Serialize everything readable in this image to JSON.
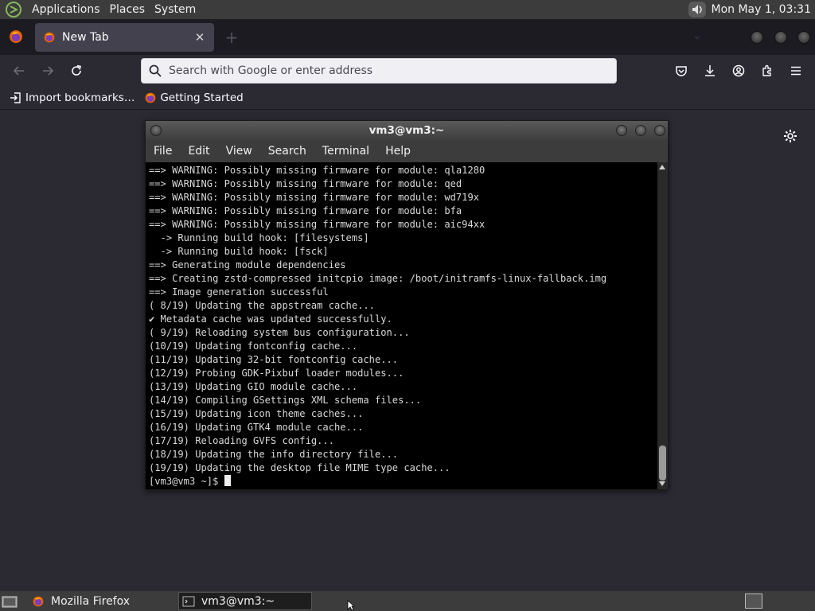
{
  "top_panel": {
    "menus": [
      "Applications",
      "Places",
      "System"
    ],
    "clock": "Mon May  1, 03:31"
  },
  "browser": {
    "tab_title": "New Tab",
    "url_placeholder": "Search with Google or enter address",
    "bookmarks": [
      "Import bookmarks…",
      "Getting Started"
    ]
  },
  "terminal": {
    "title": "vm3@vm3:~",
    "menus": [
      "File",
      "Edit",
      "View",
      "Search",
      "Terminal",
      "Help"
    ],
    "lines": [
      "==> WARNING: Possibly missing firmware for module: qla1280",
      "==> WARNING: Possibly missing firmware for module: qed",
      "==> WARNING: Possibly missing firmware for module: wd719x",
      "==> WARNING: Possibly missing firmware for module: bfa",
      "==> WARNING: Possibly missing firmware for module: aic94xx",
      "  -> Running build hook: [filesystems]",
      "  -> Running build hook: [fsck]",
      "==> Generating module dependencies",
      "==> Creating zstd-compressed initcpio image: /boot/initramfs-linux-fallback.img",
      "==> Image generation successful",
      "( 8/19) Updating the appstream cache...",
      "✔ Metadata cache was updated successfully.",
      "( 9/19) Reloading system bus configuration...",
      "(10/19) Updating fontconfig cache...",
      "(11/19) Updating 32-bit fontconfig cache...",
      "(12/19) Probing GDK-Pixbuf loader modules...",
      "(13/19) Updating GIO module cache...",
      "(14/19) Compiling GSettings XML schema files...",
      "(15/19) Updating icon theme caches...",
      "(16/19) Updating GTK4 module cache...",
      "(17/19) Reloading GVFS config...",
      "(18/19) Updating the info directory file...",
      "(19/19) Updating the desktop file MIME type cache..."
    ],
    "prompt": "[vm3@vm3 ~]$ "
  },
  "taskbar": {
    "tasks": [
      "Mozilla Firefox",
      "vm3@vm3:~"
    ]
  },
  "colors": {
    "panel_bg": "#3c3c3c",
    "browser_bg": "#2b2a33",
    "tabstrip_bg": "#1c1b22",
    "terminal_bg": "#000000",
    "terminal_fg": "#d8d8d8"
  }
}
